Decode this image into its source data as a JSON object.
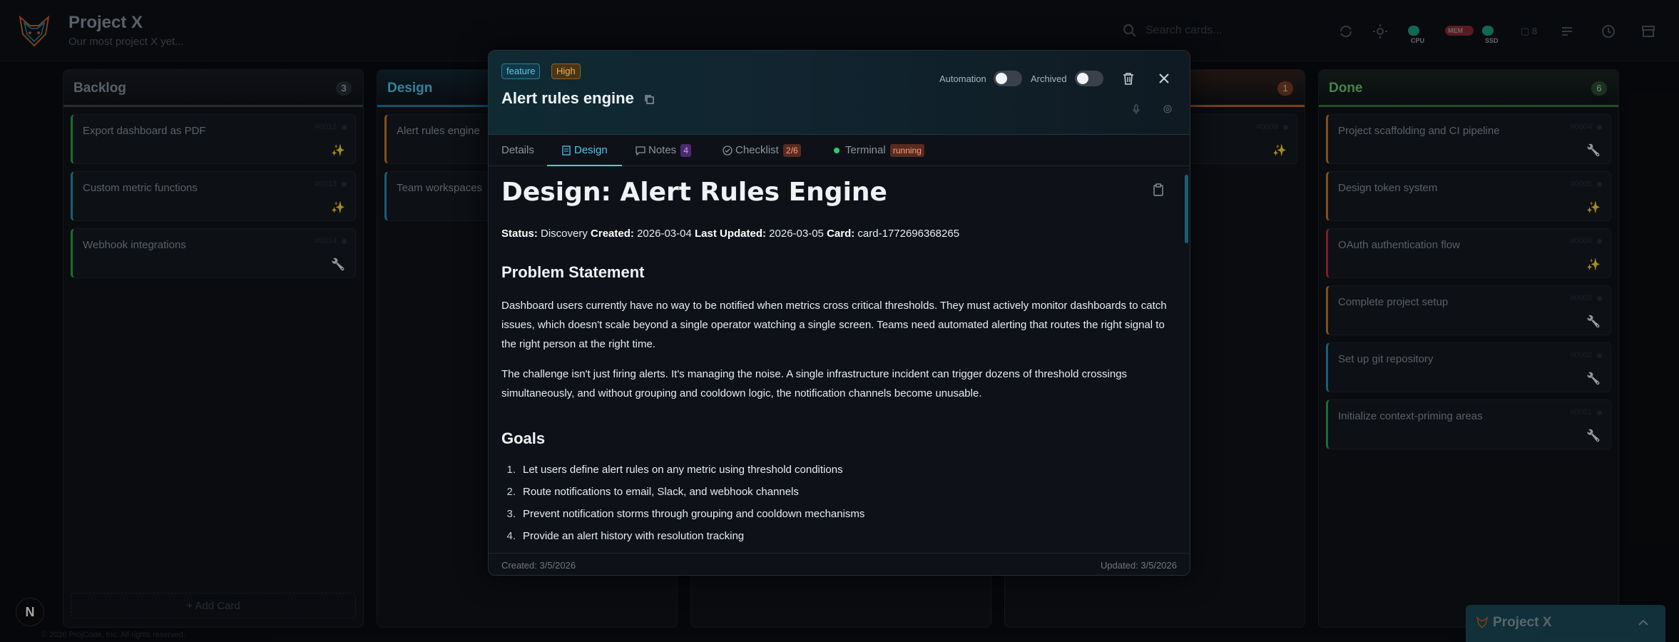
{
  "app": {
    "title": "Project X",
    "subtitle": "Our most project X yet..."
  },
  "search": {
    "placeholder": "Search cards..."
  },
  "header_pills": [
    {
      "label": "CPU",
      "color": "#1aa085"
    },
    {
      "label": "MEM",
      "color": "#b8323c"
    },
    {
      "label": "SSD",
      "color": "#1aa085"
    }
  ],
  "header_count": "8",
  "columns": [
    {
      "title": "Backlog",
      "count": "3",
      "accent": "#3b4250",
      "title_color": "#8b949e",
      "cards": [
        {
          "title": "Export dashboard as PDF",
          "id": "#0012",
          "border": "#2aa84a",
          "badge": "sparkle"
        },
        {
          "title": "Custom metric functions",
          "id": "#0013",
          "border": "#2a8fb8",
          "badge": "sparkle"
        },
        {
          "title": "Webhook integrations",
          "id": "#0014",
          "border": "#2aa84a",
          "badge": "wrench"
        }
      ],
      "add_label": "+ Add Card"
    },
    {
      "title": "Design",
      "count": "",
      "accent": "#1b7fa6",
      "title_color": "#4cc9f0",
      "cards": [
        {
          "title": "Alert rules engine",
          "id": "",
          "border": "#c87a2a",
          "badge": ""
        },
        {
          "title": "Team workspaces",
          "id": "",
          "border": "#2a8fb8",
          "badge": ""
        }
      ]
    },
    {
      "title": "",
      "count": "",
      "accent": "#1c222b",
      "title_color": "#8b949e",
      "cards": []
    },
    {
      "title": "",
      "count": "1",
      "accent": "#c0602a",
      "title_color": "#8b949e",
      "cards": [
        {
          "title": "",
          "id": "#0009",
          "border": "#1c222b",
          "badge": "sparkle"
        }
      ]
    },
    {
      "title": "Done",
      "count": "6",
      "accent": "#3a7a3a",
      "title_color": "#6fc96f",
      "cards": [
        {
          "title": "Project scaffolding and CI pipeline",
          "id": "#0004",
          "border": "#c87a2a",
          "badge": "wrench"
        },
        {
          "title": "Design token system",
          "id": "#0005",
          "border": "#c87a2a",
          "badge": "sparkle"
        },
        {
          "title": "OAuth authentication flow",
          "id": "#0006",
          "border": "#c0303a",
          "badge": "sparkle"
        },
        {
          "title": "Complete project setup",
          "id": "#0003",
          "border": "#c87a2a",
          "badge": "wrench"
        },
        {
          "title": "Set up git repository",
          "id": "#0002",
          "border": "#2a8fb8",
          "badge": "wrench"
        },
        {
          "title": "Initialize context-priming areas",
          "id": "#0001",
          "border": "#2aa84a",
          "badge": "wrench"
        }
      ]
    }
  ],
  "footer": {
    "next_label": "N",
    "copyright": "© 2026 ProjCode, Inc. All rights reserved.",
    "bottom_bar_title": "Project X"
  },
  "modal": {
    "tags": {
      "type": "feature",
      "priority": "High"
    },
    "title": "Alert rules engine",
    "automation_label": "Automation",
    "archived_label": "Archived",
    "tabs": [
      {
        "label": "Details",
        "badge": ""
      },
      {
        "label": "Design",
        "badge": ""
      },
      {
        "label": "Notes",
        "badge": "4"
      },
      {
        "label": "Checklist",
        "badge": "2/6"
      },
      {
        "label": "Terminal",
        "badge": "running"
      }
    ],
    "doc": {
      "heading": "Design: Alert Rules Engine",
      "meta": {
        "status_label": "Status:",
        "status": "Discovery",
        "created_label": "Created:",
        "created": "2026-03-04",
        "updated_label": "Last Updated:",
        "updated": "2026-03-05",
        "card_label": "Card:",
        "card": "card-1772696368265"
      },
      "section1_title": "Problem Statement",
      "para1": "Dashboard users currently have no way to be notified when metrics cross critical thresholds. They must actively monitor dashboards to catch issues, which doesn't scale beyond a single operator watching a single screen. Teams need automated alerting that routes the right signal to the right person at the right time.",
      "para2": "The challenge isn't just firing alerts. It's managing the noise. A single infrastructure incident can trigger dozens of threshold crossings simultaneously, and without grouping and cooldown logic, the notification channels become unusable.",
      "section2_title": "Goals",
      "goals": [
        "Let users define alert rules on any metric using threshold conditions",
        "Route notifications to email, Slack, and webhook channels",
        "Prevent notification storms through grouping and cooldown mechanisms",
        "Provide an alert history with resolution tracking"
      ]
    },
    "footer_created": "Created: 3/5/2026",
    "footer_updated": "Updated: 3/5/2026"
  }
}
